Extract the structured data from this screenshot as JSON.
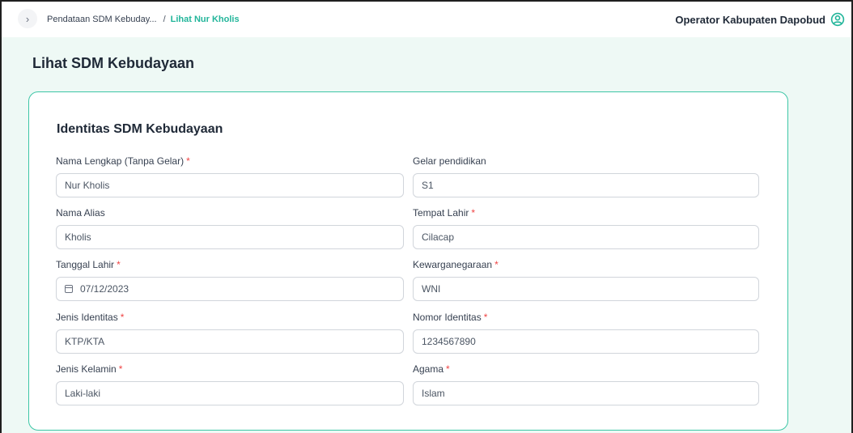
{
  "topbar": {
    "expand_glyph": "›",
    "breadcrumb": [
      {
        "label": "Pendataan SDM Kebuday..."
      },
      {
        "label": "Lihat Nur Kholis"
      }
    ],
    "separator": "/",
    "user_name": "Operator Kabupaten Dapobud"
  },
  "page_title": "Lihat SDM Kebudayaan",
  "section_title": "Identitas SDM Kebudayaan",
  "required_marker": "*",
  "fields": {
    "nama_lengkap": {
      "label": "Nama Lengkap (Tanpa Gelar)",
      "value": "Nur Kholis",
      "required": true
    },
    "gelar": {
      "label": "Gelar pendidikan",
      "value": "S1",
      "required": false
    },
    "nama_alias": {
      "label": "Nama Alias",
      "value": "Kholis",
      "required": false
    },
    "tempat_lahir": {
      "label": "Tempat Lahir",
      "value": "Cilacap",
      "required": true
    },
    "tanggal_lahir": {
      "label": "Tanggal Lahir",
      "value": "07/12/2023",
      "required": true
    },
    "kewarganegaraan": {
      "label": "Kewarganegaraan",
      "value": "WNI",
      "required": true
    },
    "jenis_identitas": {
      "label": "Jenis Identitas",
      "value": "KTP/KTA",
      "required": true
    },
    "nomor_identitas": {
      "label": "Nomor Identitas",
      "value": "1234567890",
      "required": true
    },
    "jenis_kelamin": {
      "label": "Jenis Kelamin",
      "value": "Laki-laki",
      "required": true
    },
    "agama": {
      "label": "Agama",
      "value": "Islam",
      "required": true
    }
  },
  "colors": {
    "accent": "#22b59a",
    "card_border": "#3dc6a6",
    "page_bg": "#eef9f5",
    "required": "#ef4444"
  }
}
